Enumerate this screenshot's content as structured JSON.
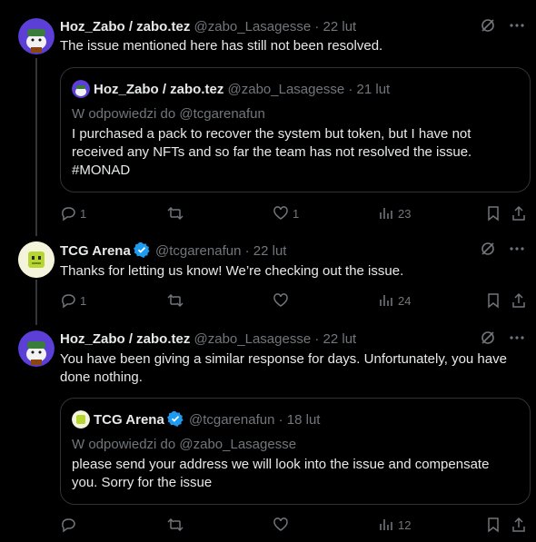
{
  "posts": [
    {
      "name": "Hoz_Zabo / zabo.tez",
      "handle": "@zabo_Lasagesse",
      "date": "22 lut",
      "text": "The issue mentioned here has still not been resolved.",
      "quote": {
        "name": "Hoz_Zabo / zabo.tez",
        "handle": "@zabo_Lasagesse",
        "date": "21 lut",
        "reply_to": "W odpowiedzi do @tcgarenafun",
        "lines": [
          "I purchased a pack to recover the system but token, but I have not",
          "received any NFTs and so far the team has not resolved the issue.",
          "#MONAD"
        ]
      },
      "stats": {
        "replies": "1",
        "reposts": "",
        "likes": "1",
        "views": "23"
      }
    },
    {
      "name": "TCG Arena",
      "handle": "@tcgarenafun",
      "date": "22 lut",
      "text": "Thanks for letting us know! We’re checking out the issue.",
      "stats": {
        "replies": "1",
        "reposts": "",
        "likes": "",
        "views": "24"
      }
    },
    {
      "name": "Hoz_Zabo / zabo.tez",
      "handle": "@zabo_Lasagesse",
      "date": "22 lut",
      "lines": [
        "You have been giving a similar response for days. Unfortunately, you have",
        "done nothing."
      ],
      "quote": {
        "name": "TCG Arena",
        "handle": "@tcgarenafun",
        "date": "18 lut",
        "reply_to": "W odpowiedzi do @zabo_Lasagesse",
        "lines": [
          "please send your address we will look into the issue and compensate",
          "you. Sorry for the issue"
        ]
      },
      "stats": {
        "replies": "",
        "reposts": "",
        "likes": "",
        "views": "12"
      }
    }
  ],
  "separator": " · ",
  "colors": {
    "accent": "#1d9bf0",
    "muted": "#71767b",
    "text": "#e7e9ea",
    "border": "#2f3336"
  }
}
